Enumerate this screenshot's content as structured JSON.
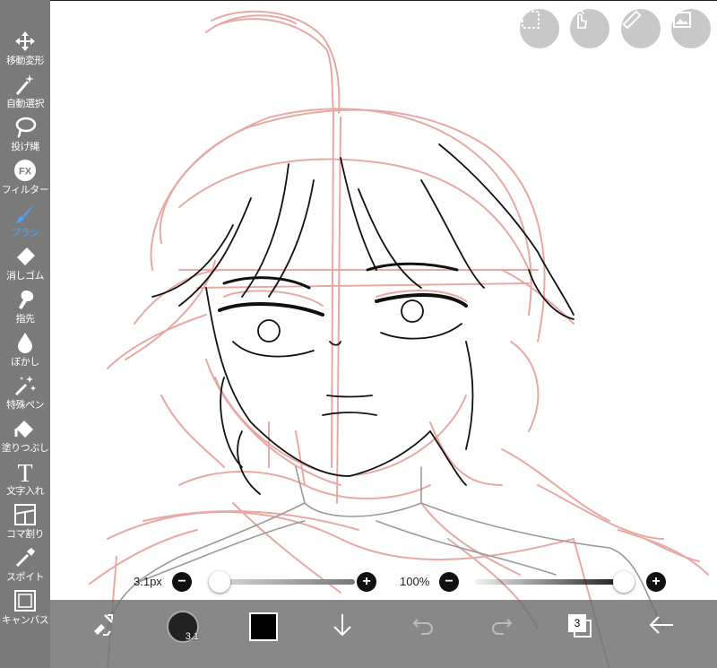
{
  "toolbar": {
    "tools": [
      {
        "label": "移動変形",
        "icon": "move-icon"
      },
      {
        "label": "自動選択",
        "icon": "magic-wand-icon"
      },
      {
        "label": "投げ縄",
        "icon": "lasso-icon"
      },
      {
        "label": "フィルター",
        "icon": "filter-fx-icon"
      },
      {
        "label": "ブラシ",
        "icon": "brush-icon"
      },
      {
        "label": "消しゴム",
        "icon": "eraser-icon"
      },
      {
        "label": "指先",
        "icon": "finger-icon"
      },
      {
        "label": "ぼかし",
        "icon": "blur-drop-icon"
      },
      {
        "label": "特殊ペン",
        "icon": "special-pen-icon"
      },
      {
        "label": "塗りつぶし",
        "icon": "fill-bucket-icon"
      },
      {
        "label": "文字入れ",
        "icon": "text-icon"
      },
      {
        "label": "コマ割り",
        "icon": "frame-divider-icon"
      },
      {
        "label": "スポイト",
        "icon": "eyedropper-icon"
      },
      {
        "label": "キャンバス",
        "icon": "canvas-icon"
      }
    ],
    "active_tool": "ブラシ",
    "active_color": "#4aa3ff"
  },
  "top_buttons": [
    "selection-icon",
    "touch-icon",
    "ruler-icon",
    "image-icon"
  ],
  "brush_size": {
    "label": "3.1px",
    "value_fraction": 0.0
  },
  "opacity": {
    "label": "100%",
    "value_fraction": 1.0
  },
  "bottom_bar": {
    "brush_size_badge": "3.1",
    "current_color": "#000000",
    "layer_count": "3"
  },
  "colors": {
    "toolbar_bg": "#7a7a7a",
    "sketch": "#e8a9a4",
    "lineart": "#111111"
  }
}
